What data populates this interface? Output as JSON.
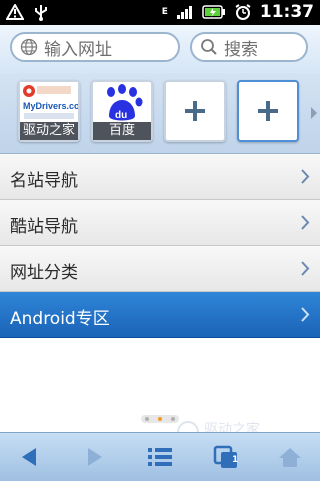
{
  "status_bar": {
    "network_type": "E",
    "time": "11:37"
  },
  "search": {
    "url_placeholder": "输入网址",
    "search_placeholder": "搜索"
  },
  "speed_dial": {
    "tiles": [
      {
        "label": "驱动之家",
        "kind": "site",
        "logo_text": "MyDrivers.com"
      },
      {
        "label": "百度",
        "kind": "site",
        "logo_text": "du"
      },
      {
        "label": "",
        "kind": "add",
        "icon": "plus-icon"
      },
      {
        "label": "",
        "kind": "add",
        "icon": "plus-icon"
      }
    ]
  },
  "nav_list": [
    {
      "label": "名站导航",
      "active": false
    },
    {
      "label": "酷站导航",
      "active": false
    },
    {
      "label": "网址分类",
      "active": false
    },
    {
      "label": "Android专区",
      "active": true
    }
  ],
  "page_indicator": {
    "count": 3,
    "current": 2
  },
  "watermark": {
    "text": "驱动之家",
    "subtext": "MyDrivers.com"
  },
  "toolbar": {
    "buttons": [
      "back-icon",
      "forward-icon",
      "menu-icon",
      "tabs-icon",
      "home-icon"
    ],
    "tab_count": "1"
  },
  "colors": {
    "accent": "#1f6fc4",
    "active_row": "#2f86d8",
    "page_dot_active": "#f39a26"
  }
}
